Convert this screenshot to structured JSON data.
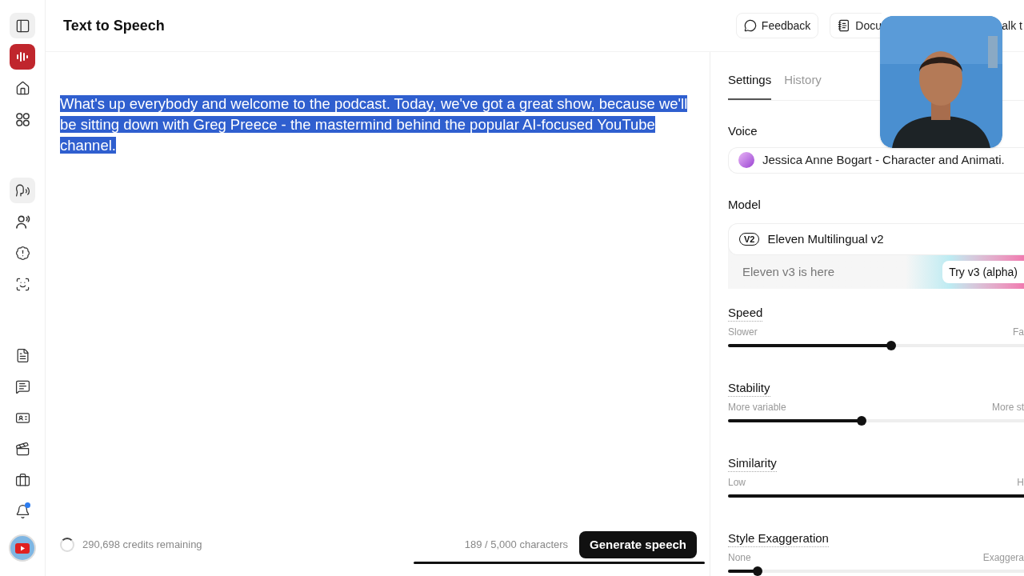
{
  "sidebar": {
    "items": [
      {
        "kind": "panel",
        "selected": true
      },
      {
        "kind": "logo",
        "selected": false
      },
      {
        "kind": "home",
        "selected": false
      },
      {
        "kind": "grid",
        "selected": false
      },
      {
        "kind": "tts",
        "selected": true
      },
      {
        "kind": "voices",
        "selected": false
      },
      {
        "kind": "badge",
        "selected": false
      },
      {
        "kind": "scan",
        "selected": false
      },
      {
        "kind": "doc",
        "selected": false
      },
      {
        "kind": "chat",
        "selected": false
      },
      {
        "kind": "card",
        "selected": false
      },
      {
        "kind": "clapper",
        "selected": false
      },
      {
        "kind": "bag",
        "selected": false
      },
      {
        "kind": "bell",
        "selected": false
      },
      {
        "kind": "avatar",
        "selected": false
      }
    ]
  },
  "header": {
    "title": "Text to Speech",
    "buttons": [
      {
        "kind": "feedback",
        "label": "Feedback"
      },
      {
        "kind": "docs",
        "label": "Docu"
      },
      {
        "kind": "talk",
        "label": "alk t"
      }
    ]
  },
  "editor": {
    "text": "What's up everybody and welcome to the podcast. Today, we've got a great show, because we'll be sitting down with Greg Preece - the mastermind behind the popular AI-focused YouTube channel.",
    "selected": true
  },
  "footer": {
    "credits": "290,698 credits remaining",
    "count": "189 / 5,000 characters",
    "button": "Generate speech"
  },
  "panel": {
    "tabs": [
      {
        "label": "Settings",
        "selected": true
      },
      {
        "label": "History",
        "selected": false
      }
    ],
    "voice": {
      "label": "Voice",
      "value": "Jessica Anne Bogart - Character and Animati."
    },
    "model": {
      "label": "Model",
      "badge": "V2",
      "value": "Eleven Multilingual v2",
      "banner": "Eleven v3 is here",
      "banner_button": "Try v3 (alpha)"
    },
    "sliders": [
      {
        "label": "Speed",
        "min_label": "Slower",
        "max_label": "Fa",
        "level": 0.55
      },
      {
        "label": "Stability",
        "min_label": "More variable",
        "max_label": "More st",
        "level": 0.45
      },
      {
        "label": "Similarity",
        "min_label": "Low",
        "max_label": "H",
        "level": 1.0
      },
      {
        "label": "Style Exaggeration",
        "min_label": "None",
        "max_label": "Exaggera",
        "level": 0.1
      }
    ]
  }
}
